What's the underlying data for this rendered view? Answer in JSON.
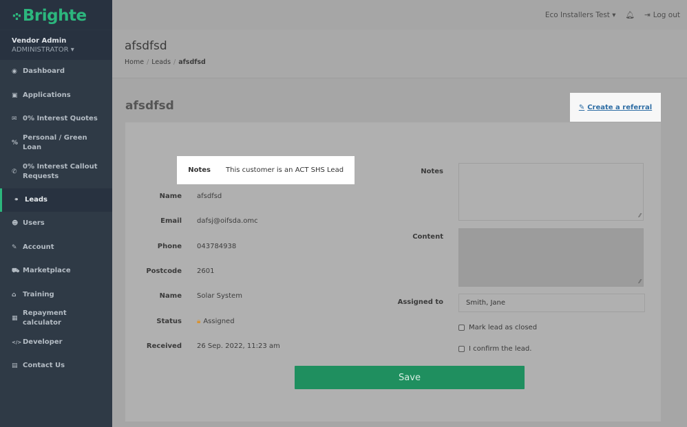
{
  "brand": {
    "logo_mark": "·:·",
    "name": "Brighte",
    "color": "#2cb67d"
  },
  "user": {
    "name": "Vendor Admin",
    "role": "ADMINISTRATOR ▾"
  },
  "nav": [
    {
      "icon": "dashboard-icon",
      "glyph": "◉",
      "label": "Dashboard"
    },
    {
      "icon": "applications-icon",
      "glyph": "▣",
      "label": "Applications"
    },
    {
      "icon": "envelope-icon",
      "glyph": "✉",
      "label": "0% Interest Quotes"
    },
    {
      "icon": "percent-icon",
      "glyph": "%",
      "label": "Personal / Green Loan"
    },
    {
      "icon": "phone-icon",
      "glyph": "✆",
      "label": "0% Interest Callout Requests"
    },
    {
      "icon": "leads-icon",
      "glyph": "⚭",
      "label": "Leads"
    },
    {
      "icon": "users-icon",
      "glyph": "☻",
      "label": "Users"
    },
    {
      "icon": "wrench-icon",
      "glyph": "✎",
      "label": "Account"
    },
    {
      "icon": "cart-icon",
      "glyph": "⛟",
      "label": "Marketplace"
    },
    {
      "icon": "graduation-cap-icon",
      "glyph": "⌂",
      "label": "Training"
    },
    {
      "icon": "calculator-icon",
      "glyph": "▦",
      "label": "Repayment calculator"
    },
    {
      "icon": "code-icon",
      "glyph": "</>",
      "label": "Developer"
    },
    {
      "icon": "document-icon",
      "glyph": "▤",
      "label": "Contact Us"
    }
  ],
  "topbar": {
    "org": "Eco Installers Test ▾",
    "logout": "Log out"
  },
  "header": {
    "title": "afsdfsd",
    "breadcrumb": [
      "Home",
      "Leads",
      "afsdfsd"
    ]
  },
  "section_title": "afsdfsd",
  "referral_label": "Create a referral",
  "details": {
    "notes": {
      "label": "Notes",
      "value": "This customer is an ACT SHS Lead"
    },
    "name": {
      "label": "Name",
      "value": "afsdfsd"
    },
    "email": {
      "label": "Email",
      "value": "dafsj@oifsda.omc"
    },
    "phone": {
      "label": "Phone",
      "value": "043784938"
    },
    "postcode": {
      "label": "Postcode",
      "value": "2601"
    },
    "product": {
      "label": "Name",
      "value": "Solar System"
    },
    "status": {
      "label": "Status",
      "value": "Assigned"
    },
    "received": {
      "label": "Received",
      "value": "26 Sep. 2022, 11:23 am"
    }
  },
  "form": {
    "notes_label": "Notes",
    "notes_value": "",
    "content_label": "Content",
    "content_value": "",
    "assigned_label": "Assigned to",
    "assigned_value": "Smith, Jane",
    "mark_closed_label": "Mark lead as closed",
    "mark_closed_checked": false,
    "confirm_label": "I confirm the lead.",
    "confirm_checked": false
  },
  "save_label": "Save"
}
